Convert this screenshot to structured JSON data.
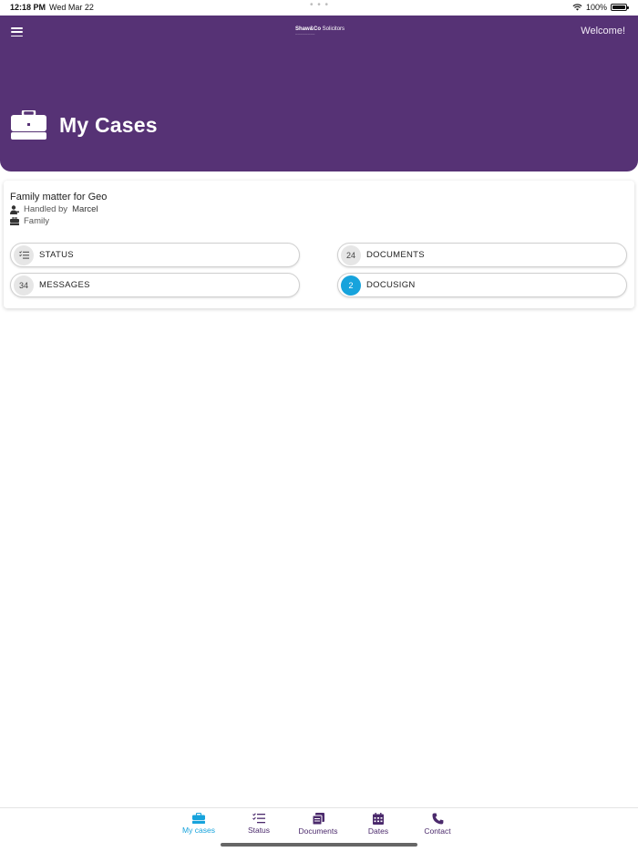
{
  "status_bar": {
    "time": "12:18 PM",
    "date": "Wed Mar 22",
    "battery": "100%"
  },
  "header": {
    "logo_text_bold": "Shaw&Co",
    "logo_text": " Solicitors",
    "welcome": "Welcome!",
    "page_title": "My Cases",
    "background_color": "#563275"
  },
  "case": {
    "title": "Family matter for Geo",
    "handled_by_label": "Handled by",
    "handler": "Marcel",
    "category": "Family",
    "buttons": {
      "status": {
        "label": "STATUS"
      },
      "documents": {
        "label": "DOCUMENTS",
        "count": "24"
      },
      "messages": {
        "label": "MESSAGES",
        "count": "34"
      },
      "docusign": {
        "label": "DOCUSIGN",
        "count": "2"
      }
    }
  },
  "bottom_nav": {
    "items": [
      {
        "label": "My cases",
        "icon": "briefcase-icon",
        "active": true
      },
      {
        "label": "Status",
        "icon": "checklist-icon",
        "active": false
      },
      {
        "label": "Documents",
        "icon": "documents-icon",
        "active": false
      },
      {
        "label": "Dates",
        "icon": "calendar-icon",
        "active": false
      },
      {
        "label": "Contact",
        "icon": "phone-icon",
        "active": false
      }
    ],
    "active_color": "#17a3dc",
    "inactive_color": "#4b2a6c"
  }
}
